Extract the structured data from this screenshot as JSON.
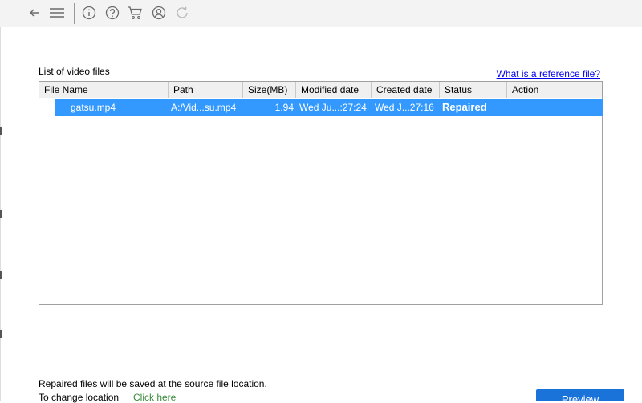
{
  "toolbar": {
    "icons": [
      "back-arrow-icon",
      "menu-icon",
      "info-icon",
      "help-icon",
      "cart-icon",
      "user-icon",
      "refresh-icon"
    ]
  },
  "list": {
    "title": "List of video files",
    "reference_link": "What is a reference file?",
    "columns": [
      "File Name",
      "Path",
      "Size(MB)",
      "Modified date",
      "Created date",
      "Status",
      "Action"
    ],
    "rows": [
      {
        "file_name": "gatsu.mp4",
        "path": "A:/Vid...su.mp4",
        "size": "1.94",
        "modified": "Wed Ju...:27:24",
        "created": "Wed J...27:16",
        "status": "Repaired",
        "action": ""
      }
    ]
  },
  "footer": {
    "save_note": "Repaired files will be saved at the source file location.",
    "change_location": "To change location",
    "click_here": "Click here",
    "preview_label": "Preview"
  },
  "colors": {
    "selection": "#3399ff",
    "link": "#0000ee",
    "click_here": "#3a8a3a",
    "primary_button": "#1a73d9"
  }
}
